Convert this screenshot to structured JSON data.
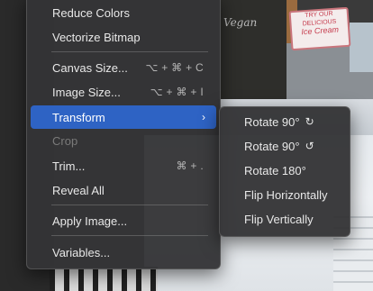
{
  "background": {
    "board_text": "Vegan",
    "sign_lines": [
      "TRY OUR",
      "DELICIOUS",
      "Ice Cream"
    ]
  },
  "main_menu": {
    "items": [
      {
        "label": "Reduce Colors"
      },
      {
        "label": "Vectorize Bitmap"
      },
      {
        "label": "Canvas Size...",
        "shortcut": "⌥ + ⌘ + C"
      },
      {
        "label": "Image Size...",
        "shortcut": "⌥ + ⌘ + I"
      },
      {
        "label": "Transform",
        "chevron": "›"
      },
      {
        "label": "Crop"
      },
      {
        "label": "Trim...",
        "shortcut": "⌘ + ."
      },
      {
        "label": "Reveal All"
      },
      {
        "label": "Apply Image..."
      },
      {
        "label": "Variables..."
      }
    ]
  },
  "transform_submenu": {
    "items": [
      {
        "label": "Rotate 90°",
        "icon": "↻",
        "icon_name": "rotate-clockwise-icon"
      },
      {
        "label": "Rotate 90°",
        "icon": "↺",
        "icon_name": "rotate-counterclockwise-icon"
      },
      {
        "label": "Rotate 180°"
      },
      {
        "label": "Flip Horizontally"
      },
      {
        "label": "Flip Vertically"
      }
    ]
  },
  "colors": {
    "highlight": "#2e63c4",
    "menu_bg": "#343436",
    "disabled_text": "#7a7a7a"
  }
}
